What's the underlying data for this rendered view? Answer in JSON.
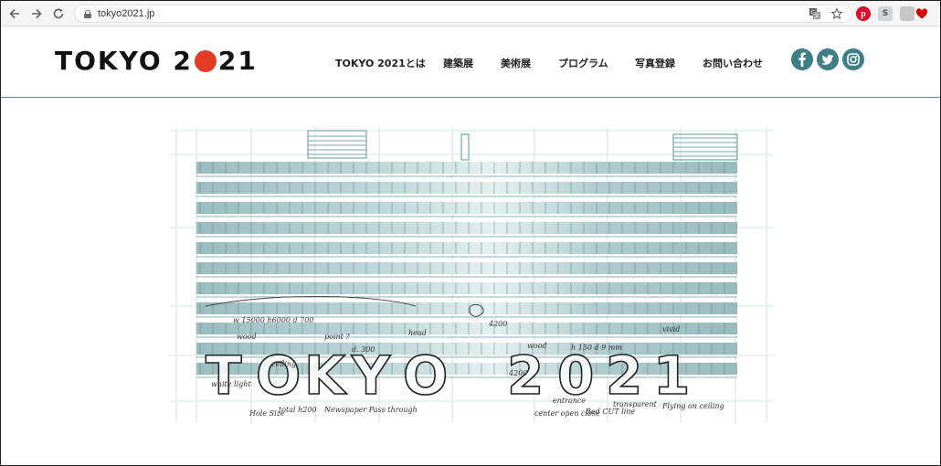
{
  "browser": {
    "url": "tokyo2021.jp",
    "icons": [
      "back-icon",
      "forward-icon",
      "reload-icon",
      "lock-icon",
      "translate-icon",
      "star-icon",
      "pinterest-icon",
      "extension-s-icon",
      "extension-gray-icon",
      "extension-heart-icon"
    ]
  },
  "site": {
    "logo": {
      "left": "TOKYO 2",
      "right": "21",
      "dot_color": "#e43c24"
    },
    "nav": [
      "TOKYO 2021とは",
      "建築展",
      "美術展",
      "プログラム",
      "写真登録",
      "お問い合わせ"
    ],
    "social": [
      "facebook-icon",
      "twitter-icon",
      "instagram-icon"
    ],
    "accent_color": "#3e7f86"
  },
  "hero": {
    "title_text": "TOKYO 2021",
    "annotations": [
      "w 15000  h6000  d 700",
      "wood",
      "ceiling",
      "point ?",
      "head",
      "d. 300",
      "4200",
      "wood",
      "h 150 d 9 mm",
      "vivid",
      "white light",
      "total h200",
      "Hole Size",
      "Newspaper Pass through",
      "entrance",
      "center open close",
      "Red CUT line",
      "transparent",
      "Flying on ceiling",
      "4200"
    ]
  }
}
